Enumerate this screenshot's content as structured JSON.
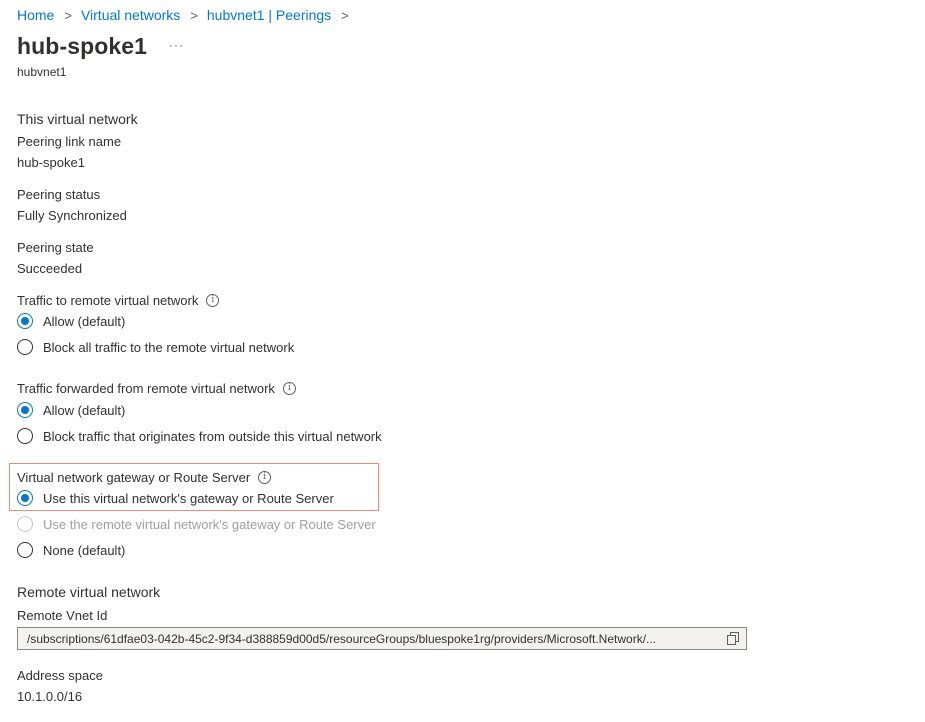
{
  "breadcrumb": [
    "Home",
    "Virtual networks",
    "hubvnet1 | Peerings"
  ],
  "header": {
    "title": "hub-spoke1",
    "more": "···",
    "subtitle": "hubvnet1"
  },
  "this_network": {
    "section_title": "This virtual network",
    "peering_link_name_label": "Peering link name",
    "peering_link_name_value": "hub-spoke1",
    "peering_status_label": "Peering status",
    "peering_status_value": "Fully Synchronized",
    "peering_state_label": "Peering state",
    "peering_state_value": "Succeeded",
    "traffic_to_remote": {
      "label": "Traffic to remote virtual network",
      "options": [
        "Allow (default)",
        "Block all traffic to the remote virtual network"
      ],
      "selected_index": 0
    },
    "traffic_forwarded": {
      "label": "Traffic forwarded from remote virtual network",
      "options": [
        "Allow (default)",
        "Block traffic that originates from outside this virtual network"
      ],
      "selected_index": 0
    },
    "gateway": {
      "label": "Virtual network gateway or Route Server",
      "options": [
        "Use this virtual network's gateway or Route Server",
        "Use the remote virtual network's gateway or Route Server",
        "None (default)"
      ],
      "selected_index": 0,
      "disabled_index": 1
    }
  },
  "remote_network": {
    "section_title": "Remote virtual network",
    "remote_vnet_id_label": "Remote Vnet Id",
    "remote_vnet_id_value": "/subscriptions/61dfae03-042b-45c2-9f34-d388859d00d5/resourceGroups/bluespoke1rg/providers/Microsoft.Network/...",
    "address_space_label": "Address space",
    "address_space_value": "10.1.0.0/16"
  },
  "colors": {
    "accent": "#0078d4",
    "highlight": "#f08a70",
    "text": "#323130",
    "disabled": "#a19f9d"
  },
  "icons": [
    "chevron-right-icon",
    "more-icon",
    "info-icon",
    "copy-icon"
  ]
}
